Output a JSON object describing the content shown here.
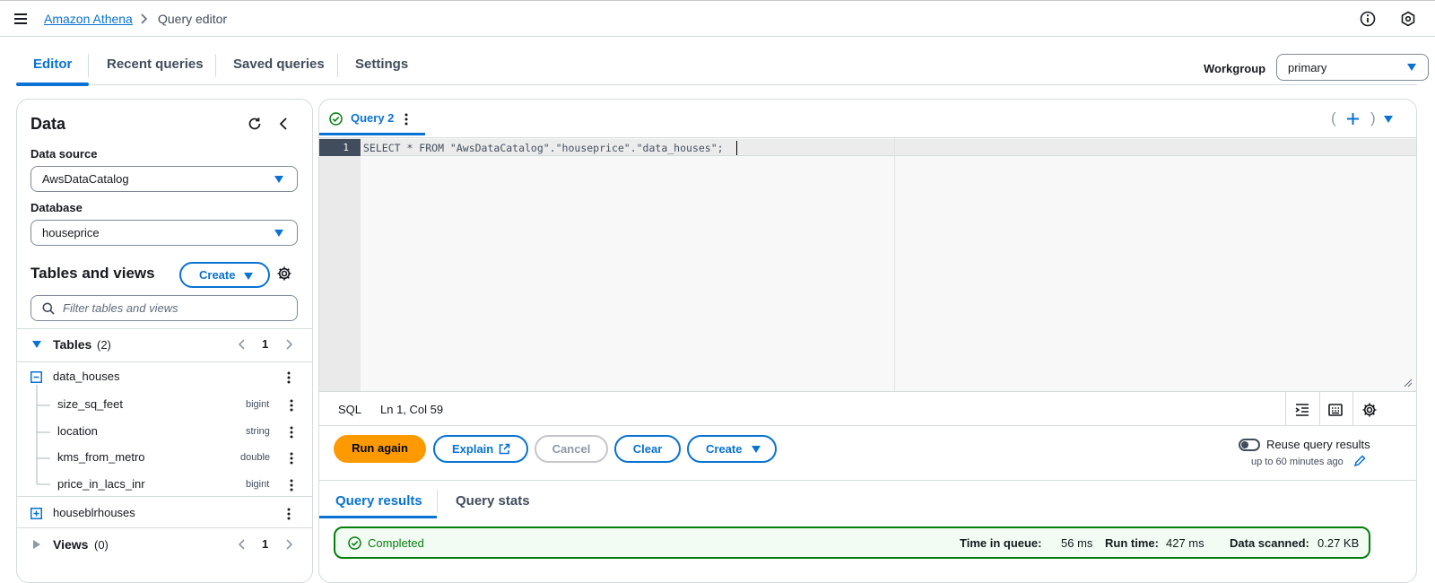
{
  "topbar": {
    "breadcrumb_service": "Amazon Athena",
    "breadcrumb_page": "Query editor"
  },
  "tabs": [
    {
      "label": "Editor",
      "active": true
    },
    {
      "label": "Recent queries",
      "active": false
    },
    {
      "label": "Saved queries",
      "active": false
    },
    {
      "label": "Settings",
      "active": false
    }
  ],
  "workgroup": {
    "label": "Workgroup",
    "value": "primary"
  },
  "data_panel": {
    "title": "Data",
    "data_source_label": "Data source",
    "data_source_value": "AwsDataCatalog",
    "database_label": "Database",
    "database_value": "houseprice",
    "tables_views_title": "Tables and views",
    "create_label": "Create",
    "filter_placeholder": "Filter tables and views",
    "tables_label": "Tables",
    "tables_count": "(2)",
    "tables_page": "1",
    "tables": [
      {
        "name": "data_houses",
        "expanded": true,
        "columns": [
          {
            "name": "size_sq_feet",
            "type": "bigint"
          },
          {
            "name": "location",
            "type": "string"
          },
          {
            "name": "kms_from_metro",
            "type": "double"
          },
          {
            "name": "price_in_lacs_inr",
            "type": "bigint"
          }
        ]
      },
      {
        "name": "houseblrhouses",
        "expanded": false
      }
    ],
    "views_label": "Views",
    "views_count": "(0)",
    "views_page": "1"
  },
  "editor": {
    "query_tab": "Query 2",
    "line_number": "1",
    "code": "SELECT * FROM \"AwsDataCatalog\".\"houseprice\".\"data_houses\";",
    "language": "SQL",
    "cursor": "Ln 1, Col 59"
  },
  "actions": {
    "run_again": "Run again",
    "explain": "Explain",
    "cancel": "Cancel",
    "clear": "Clear",
    "create": "Create",
    "reuse_label": "Reuse query results",
    "reuse_sub": "up to 60 minutes ago"
  },
  "results": {
    "tabs": [
      "Query results",
      "Query stats"
    ],
    "status": "Completed",
    "time_in_queue_label": "Time in queue:",
    "time_in_queue": "56 ms",
    "run_time_label": "Run time:",
    "run_time": "427 ms",
    "data_scanned_label": "Data scanned:",
    "data_scanned": "0.27 KB"
  },
  "colors": {
    "accent": "#0972d3",
    "primary_button": "#ff9900",
    "success": "#037f0c"
  }
}
